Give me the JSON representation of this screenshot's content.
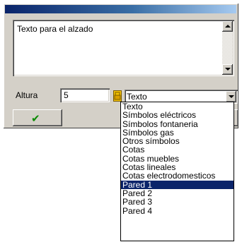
{
  "dialog": {
    "memo_text": "Texto para el alzado",
    "height_label": "Altura",
    "height_value": "5",
    "combo_selected": "Texto",
    "ok_icon": "checkmark-icon"
  },
  "dropdown": {
    "items": [
      "Texto",
      "Símbolos eléctricos",
      "Símbolos fontaneria",
      "Símbolos gas",
      "Otros símbolos",
      "Cotas",
      "Cotas muebles",
      "Cotas lineales",
      "Cotas electrodomesticos",
      "Pared 1",
      "Pared 2",
      "Pared 3",
      "Pared 4"
    ],
    "highlighted_index": 9
  },
  "colors": {
    "title_bar_start": "#0a246a",
    "title_bar_end": "#a6caf0",
    "selection_bg": "#0a246a",
    "dialog_bg": "#d4d0c8",
    "checkmark": "#0a8a00"
  }
}
